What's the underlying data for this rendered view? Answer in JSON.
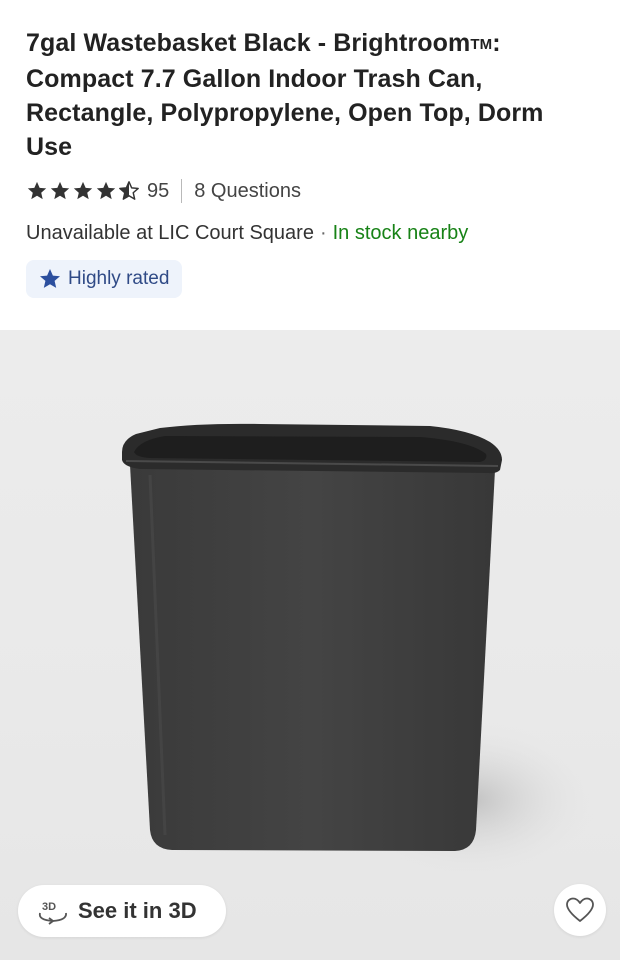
{
  "product": {
    "title_line1": "7gal Wastebasket Black - Brightroom",
    "trademark": "TM",
    "title_line1_end": ":",
    "title_rest": "Compact 7.7 Gallon Indoor Trash Can, Rectangle, Polypropylene, Open Top, Dorm Use"
  },
  "rating": {
    "stars": 4.5,
    "review_count": "95",
    "questions": "8 Questions"
  },
  "availability": {
    "store_text": "Unavailable at LIC Court Square",
    "separator": "·",
    "stock_text": "In stock nearby",
    "stock_color": "#178216"
  },
  "badge": {
    "icon": "star-icon",
    "label": "Highly rated"
  },
  "gallery": {
    "image": "black-rectangular-wastebasket",
    "view_3d_label": "See it in 3D",
    "view_3d_icon": "3d-rotate-icon",
    "favorite_icon": "heart-outline-icon"
  },
  "colors": {
    "title": "#222222",
    "badge_bg": "#eef3fb",
    "badge_star": "#2c4f9e",
    "gallery_bg": "#ececec"
  }
}
